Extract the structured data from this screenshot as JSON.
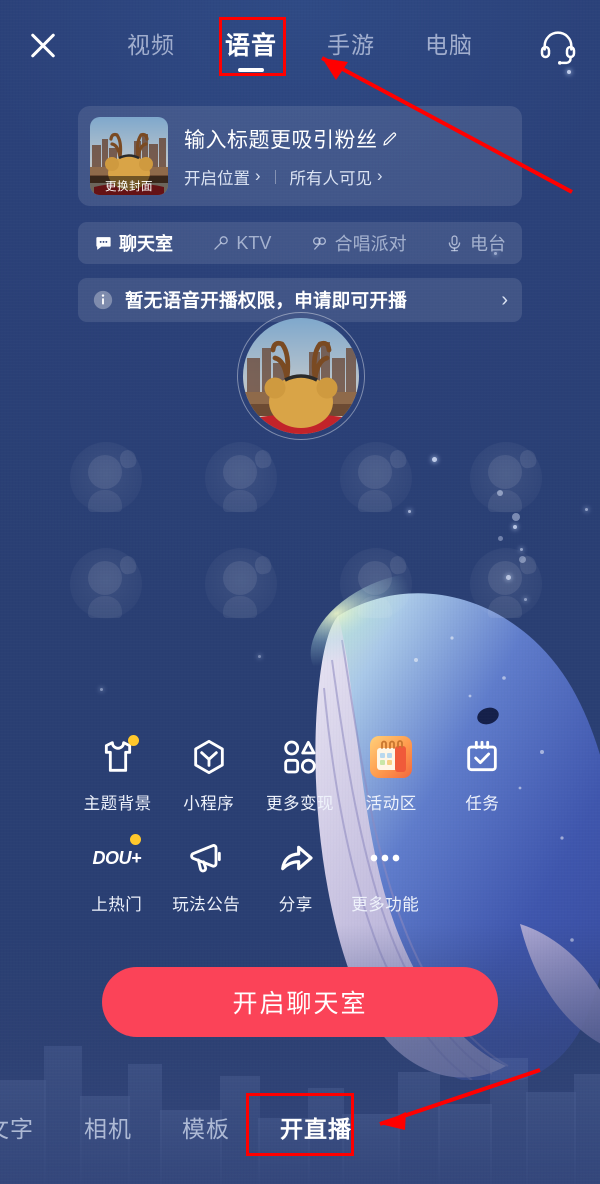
{
  "theme": {
    "bg_deep_blue": "#2b4178",
    "accent_red": "#FB4358",
    "badge_yellow": "#FFC82C",
    "annotation_red": "#FF0000",
    "text_primary": "#ffffff",
    "text_muted": "#cdd6eb"
  },
  "topbar": {
    "close_label": "",
    "tabs": [
      {
        "label": "视频",
        "active": false
      },
      {
        "label": "语音",
        "active": true
      },
      {
        "label": "手游",
        "active": false
      },
      {
        "label": "电脑",
        "active": false
      }
    ],
    "service_icon": "headset-icon"
  },
  "title_card": {
    "cover_badge": "更换封面",
    "title": "输入标题更吸引粉丝",
    "edit_icon": "pencil-icon",
    "location": "开启位置",
    "location_chevron": "›",
    "visibility": "所有人可见",
    "visibility_chevron": "›"
  },
  "modes": [
    {
      "label": "聊天室",
      "icon": "chat-bubble-icon",
      "active": true
    },
    {
      "label": "KTV",
      "icon": "microphone-icon",
      "active": false
    },
    {
      "label": "合唱派对",
      "icon": "duet-mic-icon",
      "active": false
    },
    {
      "label": "电台",
      "icon": "radio-mic-icon",
      "active": false
    }
  ],
  "notice": {
    "icon": "info-icon",
    "text": "暂无语音开播权限，申请即可开播",
    "chevron": "›"
  },
  "stage": {
    "host_avatar": "host-avatar",
    "empty_seat_count": 8
  },
  "tools": {
    "row1": [
      {
        "label": "主题背景",
        "icon": "tshirt-icon",
        "badge": true
      },
      {
        "label": "小程序",
        "icon": "mini-program-icon",
        "badge": false
      },
      {
        "label": "更多变现",
        "icon": "monetize-shapes-icon",
        "badge": false
      },
      {
        "label": "活动区",
        "icon": "calendar-activity-icon",
        "badge": false
      },
      {
        "label": "任务",
        "icon": "task-check-icon",
        "badge": false
      }
    ],
    "row2": [
      {
        "label": "上热门",
        "icon": "dou-plus-icon",
        "badge": true
      },
      {
        "label": "玩法公告",
        "icon": "megaphone-icon",
        "badge": false
      },
      {
        "label": "分享",
        "icon": "share-arrow-icon",
        "badge": false
      },
      {
        "label": "更多功能",
        "icon": "more-dots-icon",
        "badge": false
      }
    ]
  },
  "cta": {
    "label": "开启聊天室"
  },
  "bottombar": {
    "tabs": [
      {
        "label": "文字",
        "active": false
      },
      {
        "label": "相机",
        "active": false
      },
      {
        "label": "模板",
        "active": false
      },
      {
        "label": "开直播",
        "active": true
      }
    ]
  },
  "annotations": {
    "voice_tab_highlight": "语音",
    "live_tab_highlight": "开直播"
  }
}
